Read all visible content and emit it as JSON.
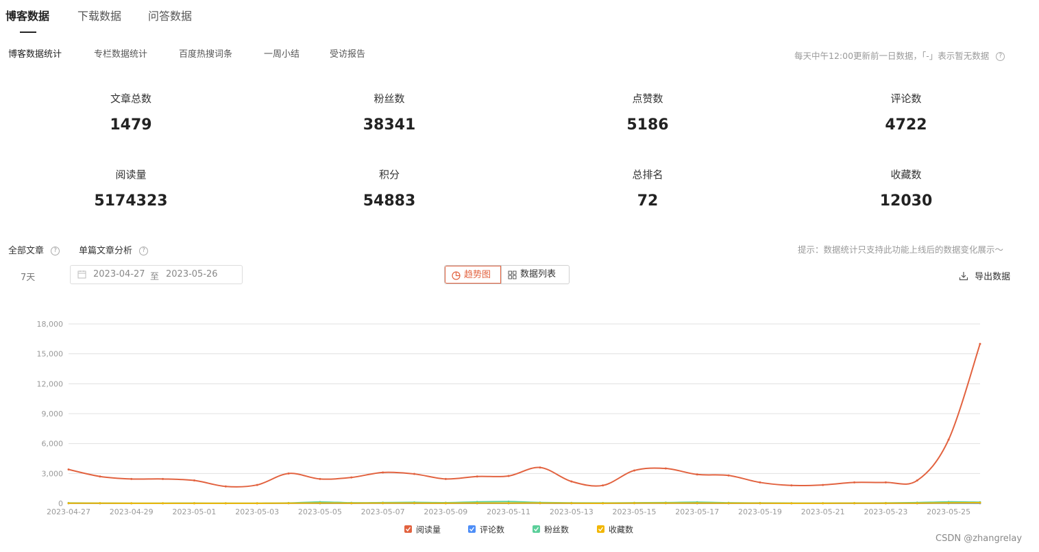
{
  "top_tabs": [
    "博客数据",
    "下载数据",
    "问答数据"
  ],
  "sub_tabs": [
    "博客数据统计",
    "专栏数据统计",
    "百度热搜词条",
    "一周小结",
    "受访报告"
  ],
  "update_note": "每天中午12:00更新前一日数据，「-」表示暂无数据",
  "stats": [
    {
      "label": "文章总数",
      "value": "1479"
    },
    {
      "label": "粉丝数",
      "value": "38341"
    },
    {
      "label": "点赞数",
      "value": "5186"
    },
    {
      "label": "评论数",
      "value": "4722"
    },
    {
      "label": "阅读量",
      "value": "5174323"
    },
    {
      "label": "积分",
      "value": "54883"
    },
    {
      "label": "总排名",
      "value": "72"
    },
    {
      "label": "收藏数",
      "value": "12030"
    }
  ],
  "analysis": {
    "all_label": "全部文章",
    "single_label": "单篇文章分析",
    "tip": "提示：数据统计只支持此功能上线后的数据变化展示～",
    "days": "7天",
    "date_start": "2023-04-27",
    "date_sep": "至",
    "date_end": "2023-05-26",
    "view_trend": "趋势图",
    "view_list": "数据列表",
    "export": "导出数据"
  },
  "watermark": "CSDN @zhangrelay",
  "icons": [
    "help-icon",
    "calendar-icon",
    "pie-chart-icon",
    "grid-icon",
    "download-icon"
  ],
  "colors": {
    "accent": "#e2623f",
    "reads": "#e2623f",
    "comments": "#4e8ef7",
    "fans": "#5bcf9a",
    "favorites": "#f2b600"
  },
  "chart_data": {
    "type": "line",
    "x": [
      "2023-04-27",
      "2023-04-28",
      "2023-04-29",
      "2023-04-30",
      "2023-05-01",
      "2023-05-02",
      "2023-05-03",
      "2023-05-04",
      "2023-05-05",
      "2023-05-06",
      "2023-05-07",
      "2023-05-08",
      "2023-05-09",
      "2023-05-10",
      "2023-05-11",
      "2023-05-12",
      "2023-05-13",
      "2023-05-14",
      "2023-05-15",
      "2023-05-16",
      "2023-05-17",
      "2023-05-18",
      "2023-05-19",
      "2023-05-20",
      "2023-05-21",
      "2023-05-22",
      "2023-05-23",
      "2023-05-24",
      "2023-05-25",
      "2023-05-26"
    ],
    "x_ticks": [
      "2023-04-27",
      "2023-04-29",
      "2023-05-01",
      "2023-05-03",
      "2023-05-05",
      "2023-05-07",
      "2023-05-09",
      "2023-05-11",
      "2023-05-13",
      "2023-05-15",
      "2023-05-17",
      "2023-05-19",
      "2023-05-21",
      "2023-05-23",
      "2023-05-25"
    ],
    "y_ticks": [
      "0",
      "3,000",
      "6,000",
      "9,000",
      "12,000",
      "15,000",
      "18,000"
    ],
    "ylim": [
      0,
      18000
    ],
    "grid": true,
    "legend_position": "bottom-center",
    "series": [
      {
        "name": "阅读量",
        "color": "#e2623f",
        "values": [
          3400,
          2700,
          2450,
          2450,
          2300,
          1700,
          1850,
          3000,
          2450,
          2600,
          3100,
          2950,
          2450,
          2700,
          2750,
          3600,
          2200,
          1800,
          3300,
          3500,
          2900,
          2800,
          2100,
          1800,
          1850,
          2100,
          2100,
          2300,
          6400,
          16000
        ]
      },
      {
        "name": "评论数",
        "color": "#4e8ef7",
        "values": [
          5,
          3,
          4,
          4,
          3,
          2,
          3,
          5,
          4,
          4,
          5,
          4,
          3,
          4,
          4,
          5,
          3,
          3,
          5,
          5,
          4,
          4,
          3,
          3,
          3,
          4,
          4,
          4,
          8,
          12
        ]
      },
      {
        "name": "粉丝数",
        "color": "#5bcf9a",
        "values": [
          40,
          30,
          20,
          20,
          25,
          15,
          20,
          40,
          140,
          60,
          80,
          100,
          70,
          150,
          180,
          90,
          50,
          40,
          60,
          80,
          120,
          60,
          40,
          30,
          25,
          35,
          40,
          80,
          150,
          120
        ]
      },
      {
        "name": "收藏数",
        "color": "#f2b600",
        "values": [
          20,
          15,
          12,
          12,
          10,
          8,
          10,
          20,
          25,
          20,
          25,
          22,
          18,
          25,
          28,
          30,
          15,
          12,
          25,
          28,
          22,
          20,
          15,
          12,
          12,
          15,
          16,
          20,
          45,
          60
        ]
      }
    ]
  }
}
